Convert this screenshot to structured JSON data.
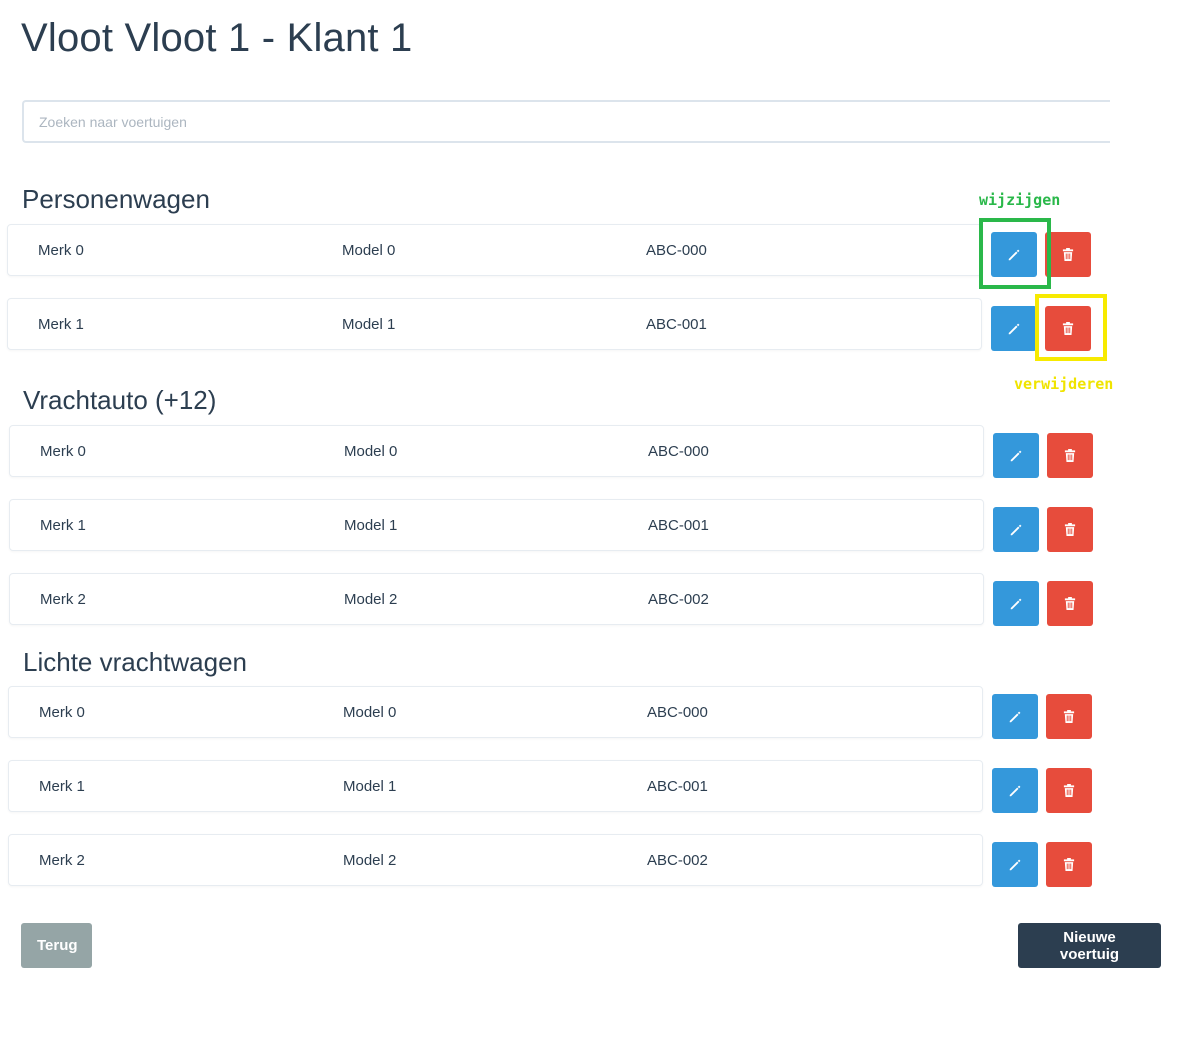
{
  "page": {
    "title": "Vloot Vloot 1 - Klant 1"
  },
  "search": {
    "placeholder": "Zoeken naar voertuigen",
    "value": ""
  },
  "sections": [
    {
      "title": "Personenwagen",
      "rows": [
        {
          "merk": "Merk 0",
          "model": "Model 0",
          "kenteken": "ABC-000"
        },
        {
          "merk": "Merk 1",
          "model": "Model 1",
          "kenteken": "ABC-001"
        }
      ]
    },
    {
      "title": "Vrachtauto (+12)",
      "rows": [
        {
          "merk": "Merk 0",
          "model": "Model 0",
          "kenteken": "ABC-000"
        },
        {
          "merk": "Merk 1",
          "model": "Model 1",
          "kenteken": "ABC-001"
        },
        {
          "merk": "Merk 2",
          "model": "Model 2",
          "kenteken": "ABC-002"
        }
      ]
    },
    {
      "title": "Lichte vrachtwagen",
      "rows": [
        {
          "merk": "Merk 0",
          "model": "Model 0",
          "kenteken": "ABC-000"
        },
        {
          "merk": "Merk 1",
          "model": "Model 1",
          "kenteken": "ABC-001"
        },
        {
          "merk": "Merk 2",
          "model": "Model 2",
          "kenteken": "ABC-002"
        }
      ]
    }
  ],
  "row_actions": {
    "edit_icon": "pencil-icon",
    "delete_icon": "trash-icon"
  },
  "annotations": {
    "edit_label": "wijzijgen",
    "delete_label": "verwijderen",
    "edit_color": "#2ab84a",
    "delete_color": "#f7ea00"
  },
  "footer": {
    "back_label": "Terug",
    "new_vehicle_label": "Nieuwe voertuig"
  },
  "colors": {
    "edit_button": "#3498db",
    "delete_button": "#e74c3c",
    "back_button": "#95a5a6",
    "primary_button": "#2c3e50",
    "text": "#2c3e50"
  }
}
